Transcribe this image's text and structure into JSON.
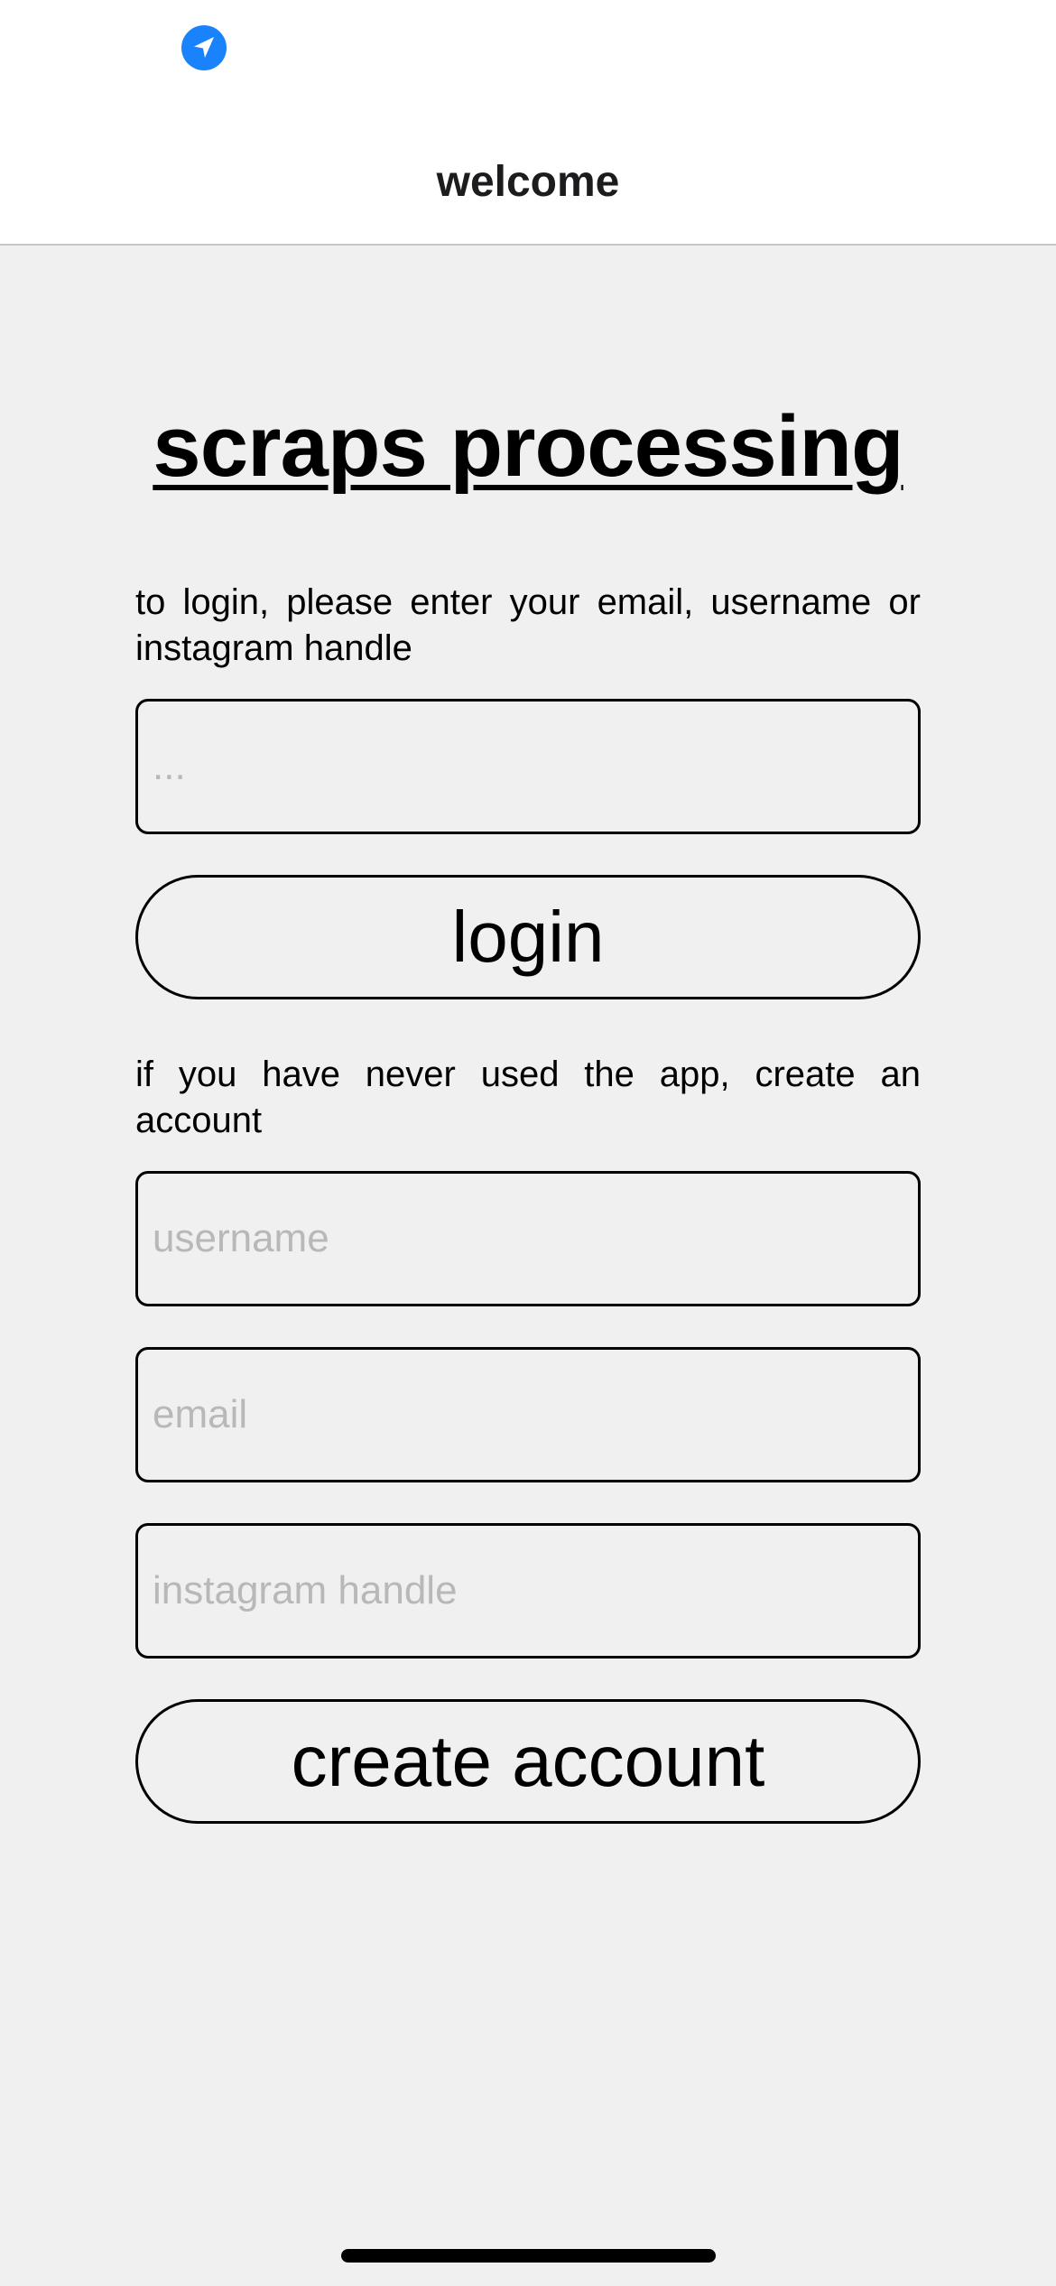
{
  "status_bar": {
    "location_icon": "location-arrow-icon",
    "icon_color": "#1a82fb"
  },
  "nav": {
    "title": "welcome"
  },
  "main": {
    "app_title": "scraps processing",
    "login_instruction": "to login, please enter your email, username or instagram handle",
    "login_input": {
      "value": "",
      "placeholder": "..."
    },
    "login_button": "login",
    "signup_instruction": "if you have never used the app, create an account",
    "username_input": {
      "value": "",
      "placeholder": "username"
    },
    "email_input": {
      "value": "",
      "placeholder": "email"
    },
    "instagram_input": {
      "value": "",
      "placeholder": "instagram handle"
    },
    "create_button": "create account"
  },
  "colors": {
    "background": "#f0f0f0",
    "header_background": "#ffffff",
    "placeholder": "#b8b8b8",
    "accent": "#1a82fb"
  }
}
